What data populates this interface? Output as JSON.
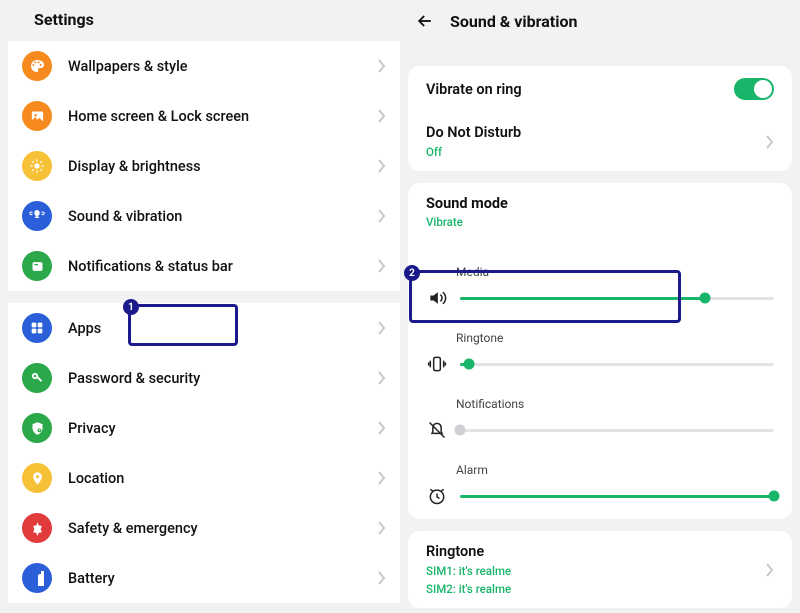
{
  "left": {
    "title": "Settings",
    "items": [
      {
        "label": "Wallpapers & style",
        "color": "#f68a1f"
      },
      {
        "label": "Home screen & Lock screen",
        "color": "#f68a1f"
      },
      {
        "label": "Display & brightness",
        "color": "#f7c137"
      },
      {
        "label": "Sound & vibration",
        "color": "#2b5fd9"
      },
      {
        "label": "Notifications & status bar",
        "color": "#2aa84a"
      },
      {
        "label": "Apps",
        "color": "#2b5fd9"
      },
      {
        "label": "Password & security",
        "color": "#2aa84a"
      },
      {
        "label": "Privacy",
        "color": "#2aa84a"
      },
      {
        "label": "Location",
        "color": "#f7c137"
      },
      {
        "label": "Safety & emergency",
        "color": "#e23b3b"
      },
      {
        "label": "Battery",
        "color": "#2b5fd9"
      }
    ]
  },
  "right": {
    "title": "Sound & vibration",
    "vibrate_on_ring": {
      "label": "Vibrate on ring",
      "on": true
    },
    "dnd": {
      "label": "Do Not Disturb",
      "status": "Off"
    },
    "sound_mode": {
      "label": "Sound mode",
      "status": "Vibrate"
    },
    "sliders": {
      "media": {
        "label": "Media",
        "value": 78
      },
      "ringtone": {
        "label": "Ringtone",
        "value": 3
      },
      "notifications": {
        "label": "Notifications",
        "value": 0
      },
      "alarm": {
        "label": "Alarm",
        "value": 100
      }
    },
    "ringtone": {
      "label": "Ringtone",
      "sim1": "SIM1: it's realme",
      "sim2": "SIM2: it's realme"
    }
  },
  "highlights": {
    "one": "1",
    "two": "2"
  }
}
